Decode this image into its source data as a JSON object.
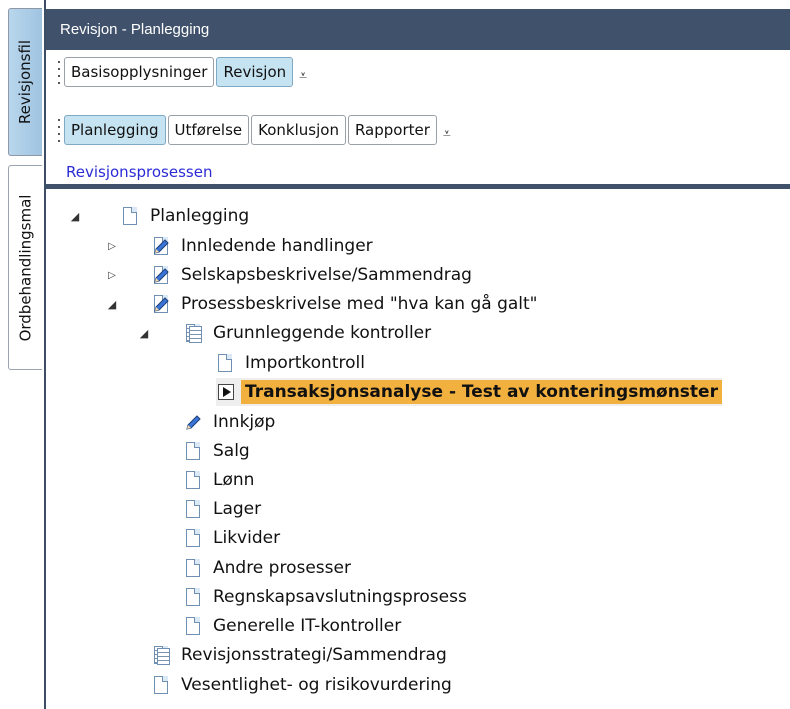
{
  "vertical_tabs": [
    {
      "label": "Revisjonsfil",
      "active": true
    },
    {
      "label": "Ordbehandlingsmal",
      "active": false
    }
  ],
  "window": {
    "title": "Revisjon - Planlegging"
  },
  "toolbar_row1": {
    "tabs": [
      "Basisopplysninger",
      "Revisjon"
    ],
    "active": "Revisjon"
  },
  "toolbar_row2": {
    "tabs": [
      "Planlegging",
      "Utførelse",
      "Konklusjon",
      "Rapporter"
    ],
    "active": "Planlegging"
  },
  "section_link": "Revisjonsprosessen",
  "tree": [
    {
      "label": "Planlegging",
      "icon": "document-icon",
      "expander": "expanded"
    },
    {
      "label": "Innledende handlinger",
      "icon": "pencil-document-icon",
      "expander": "collapsed"
    },
    {
      "label": "Selskapsbeskrivelse/Sammendrag",
      "icon": "pencil-document-icon",
      "expander": "collapsed"
    },
    {
      "label": "Prosessbeskrivelse med \"hva kan gå galt\"",
      "icon": "pencil-document-icon",
      "expander": "expanded"
    },
    {
      "label": "Grunnleggende kontroller",
      "icon": "multi-document-icon",
      "expander": "expanded"
    },
    {
      "label": "Importkontroll",
      "icon": "document-icon",
      "expander": ""
    },
    {
      "label": "Transaksjonsanalyse - Test av konteringsmønster",
      "icon": "play-icon",
      "expander": "",
      "selected": true
    },
    {
      "label": "Innkjøp",
      "icon": "pencil-icon",
      "expander": ""
    },
    {
      "label": "Salg",
      "icon": "document-icon",
      "expander": ""
    },
    {
      "label": "Lønn",
      "icon": "document-icon",
      "expander": ""
    },
    {
      "label": "Lager",
      "icon": "document-icon",
      "expander": ""
    },
    {
      "label": "Likvider",
      "icon": "document-icon",
      "expander": ""
    },
    {
      "label": "Andre prosesser",
      "icon": "document-icon",
      "expander": ""
    },
    {
      "label": "Regnskapsavslutningsprosess",
      "icon": "document-icon",
      "expander": ""
    },
    {
      "label": "Generelle IT-kontroller",
      "icon": "document-icon",
      "expander": ""
    },
    {
      "label": "Revisjonsstrategi/Sammendrag",
      "icon": "multi-document-icon",
      "expander": ""
    },
    {
      "label": "Vesentlighet- og risikovurdering",
      "icon": "document-icon",
      "expander": ""
    }
  ],
  "colors": {
    "header": "#40526b",
    "active_tab": "#c6e3f1",
    "selection": "#f2b13f",
    "link": "#2b2bd6"
  }
}
